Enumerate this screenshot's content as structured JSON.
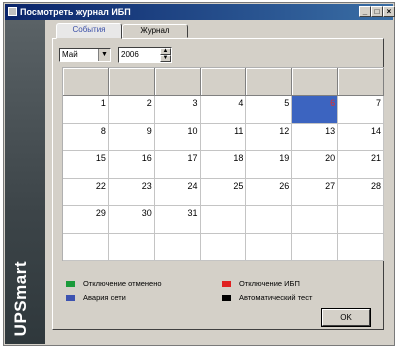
{
  "window": {
    "title": "Посмотреть журнал ИБП",
    "minimize_label": "_",
    "maximize_label": "□",
    "close_label": "×"
  },
  "sidebar": {
    "brand": "UPSmart"
  },
  "tabs": [
    {
      "label": "События",
      "active": true
    },
    {
      "label": "Журнал",
      "active": false
    }
  ],
  "controls": {
    "month_value": "Май",
    "month_arrow": "▼",
    "year_value": "2006",
    "spin_up": "▲",
    "spin_down": "▼"
  },
  "calendar": {
    "selected_day": "6",
    "weeks": [
      [
        "",
        "",
        "",
        "",
        "",
        "",
        ""
      ],
      [
        "1",
        "2",
        "3",
        "4",
        "5",
        "6",
        "7"
      ],
      [
        "8",
        "9",
        "10",
        "11",
        "12",
        "13",
        "14"
      ],
      [
        "15",
        "16",
        "17",
        "18",
        "19",
        "20",
        "21"
      ],
      [
        "22",
        "23",
        "24",
        "25",
        "26",
        "27",
        "28"
      ],
      [
        "29",
        "30",
        "31",
        "",
        "",
        "",
        ""
      ],
      [
        "",
        "",
        "",
        "",
        "",
        "",
        ""
      ]
    ]
  },
  "legend": [
    {
      "label": "Отключение отменено",
      "color": "#1a9a3a"
    },
    {
      "label": "Отключение ИБП",
      "color": "#e02020"
    },
    {
      "label": "Авария сети",
      "color": "#3c52b0"
    },
    {
      "label": "Автоматический тест",
      "color": "#000000"
    }
  ],
  "ok_label": "OK"
}
